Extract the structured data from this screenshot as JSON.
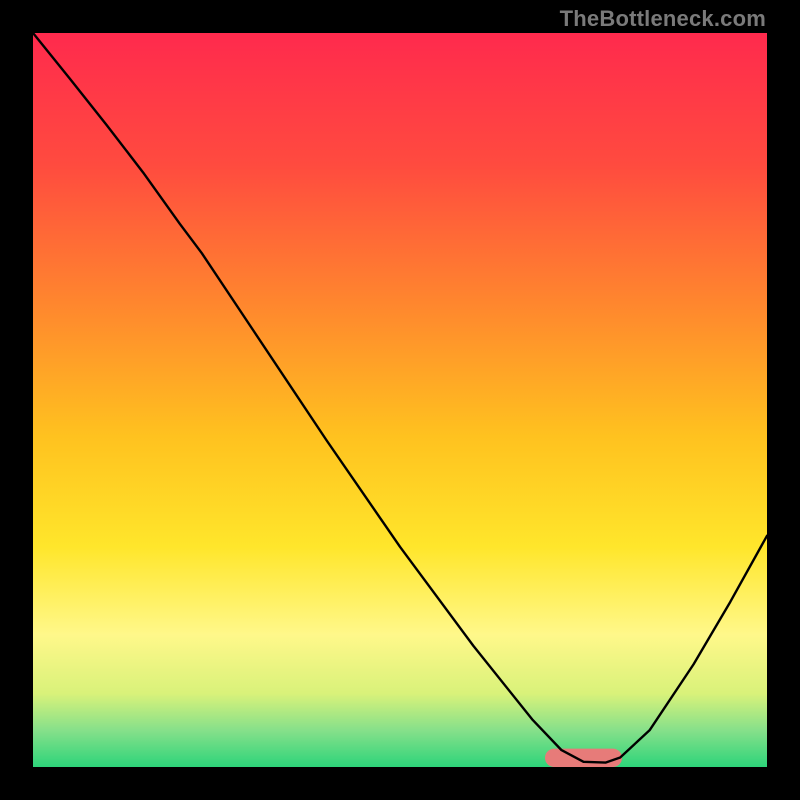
{
  "watermark": "TheBottleneck.com",
  "chart_data": {
    "type": "line",
    "title": "",
    "xlabel": "",
    "ylabel": "",
    "xlim": [
      0,
      100
    ],
    "ylim": [
      0,
      100
    ],
    "grid": false,
    "legend": false,
    "background_gradient_stops": [
      {
        "offset": 0.0,
        "color": "#ff2a4d"
      },
      {
        "offset": 0.18,
        "color": "#ff4b3f"
      },
      {
        "offset": 0.38,
        "color": "#ff8a2d"
      },
      {
        "offset": 0.55,
        "color": "#ffc21f"
      },
      {
        "offset": 0.7,
        "color": "#ffe62b"
      },
      {
        "offset": 0.82,
        "color": "#fff88a"
      },
      {
        "offset": 0.9,
        "color": "#d9f27a"
      },
      {
        "offset": 0.95,
        "color": "#86e08a"
      },
      {
        "offset": 1.0,
        "color": "#2dd47a"
      }
    ],
    "series": [
      {
        "name": "curve",
        "color": "#000000",
        "width": 2.4,
        "x": [
          0.0,
          5.0,
          10.0,
          15.0,
          20.0,
          23.0,
          30.0,
          40.0,
          50.0,
          60.0,
          68.0,
          72.0,
          75.0,
          78.0,
          80.0,
          84.0,
          90.0,
          95.0,
          100.0
        ],
        "y": [
          100.0,
          93.8,
          87.5,
          81.0,
          74.0,
          70.0,
          59.5,
          44.5,
          30.0,
          16.5,
          6.5,
          2.3,
          0.7,
          0.6,
          1.3,
          5.0,
          14.0,
          22.5,
          31.5
        ]
      }
    ],
    "marker": {
      "name": "optimal-region",
      "color": "#e77b79",
      "x_center": 75.0,
      "y": 0.0,
      "half_width": 4.0,
      "thickness": 2.5
    }
  }
}
